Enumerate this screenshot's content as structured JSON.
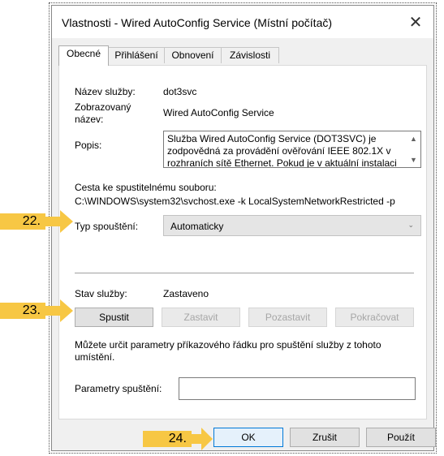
{
  "dialog": {
    "title": "Vlastnosti - Wired AutoConfig Service (Místní počítač)",
    "close_glyph": "✕"
  },
  "tabs": [
    {
      "label": "Obecné",
      "active": true
    },
    {
      "label": "Přihlášení",
      "active": false
    },
    {
      "label": "Obnovení",
      "active": false
    },
    {
      "label": "Závislosti",
      "active": false
    }
  ],
  "general": {
    "service_name_label": "Název služby:",
    "service_name_value": "dot3svc",
    "display_name_label_1": "Zobrazovaný",
    "display_name_label_2": "název:",
    "display_name_value": "Wired AutoConfig Service",
    "description_label": "Popis:",
    "description_text": "Služba Wired AutoConfig Service (DOT3SVC) je zodpovědná za provádění ověřování IEEE 802.1X v rozhraních sítě Ethernet. Pokud je v aktuální instalaci",
    "path_label": "Cesta ke spustitelnému souboru:",
    "path_value": "C:\\WINDOWS\\system32\\svchost.exe -k LocalSystemNetworkRestricted -p",
    "startup_type_label": "Typ spouštění:",
    "startup_type_value": "Automaticky",
    "status_label": "Stav služby:",
    "status_value": "Zastaveno",
    "buttons": {
      "start": "Spustit",
      "stop": "Zastavit",
      "pause": "Pozastavit",
      "resume": "Pokračovat"
    },
    "hint": "Můžete určit parametry příkazového řádku pro spuštění služby z tohoto umístění.",
    "params_label": "Parametry spuštění:",
    "params_value": ""
  },
  "footer": {
    "ok": "OK",
    "cancel": "Zrušit",
    "apply": "Použít"
  },
  "annotations": {
    "marker_22": "22.",
    "marker_23": "23.",
    "marker_24": "24.",
    "color": "#f7c744"
  }
}
